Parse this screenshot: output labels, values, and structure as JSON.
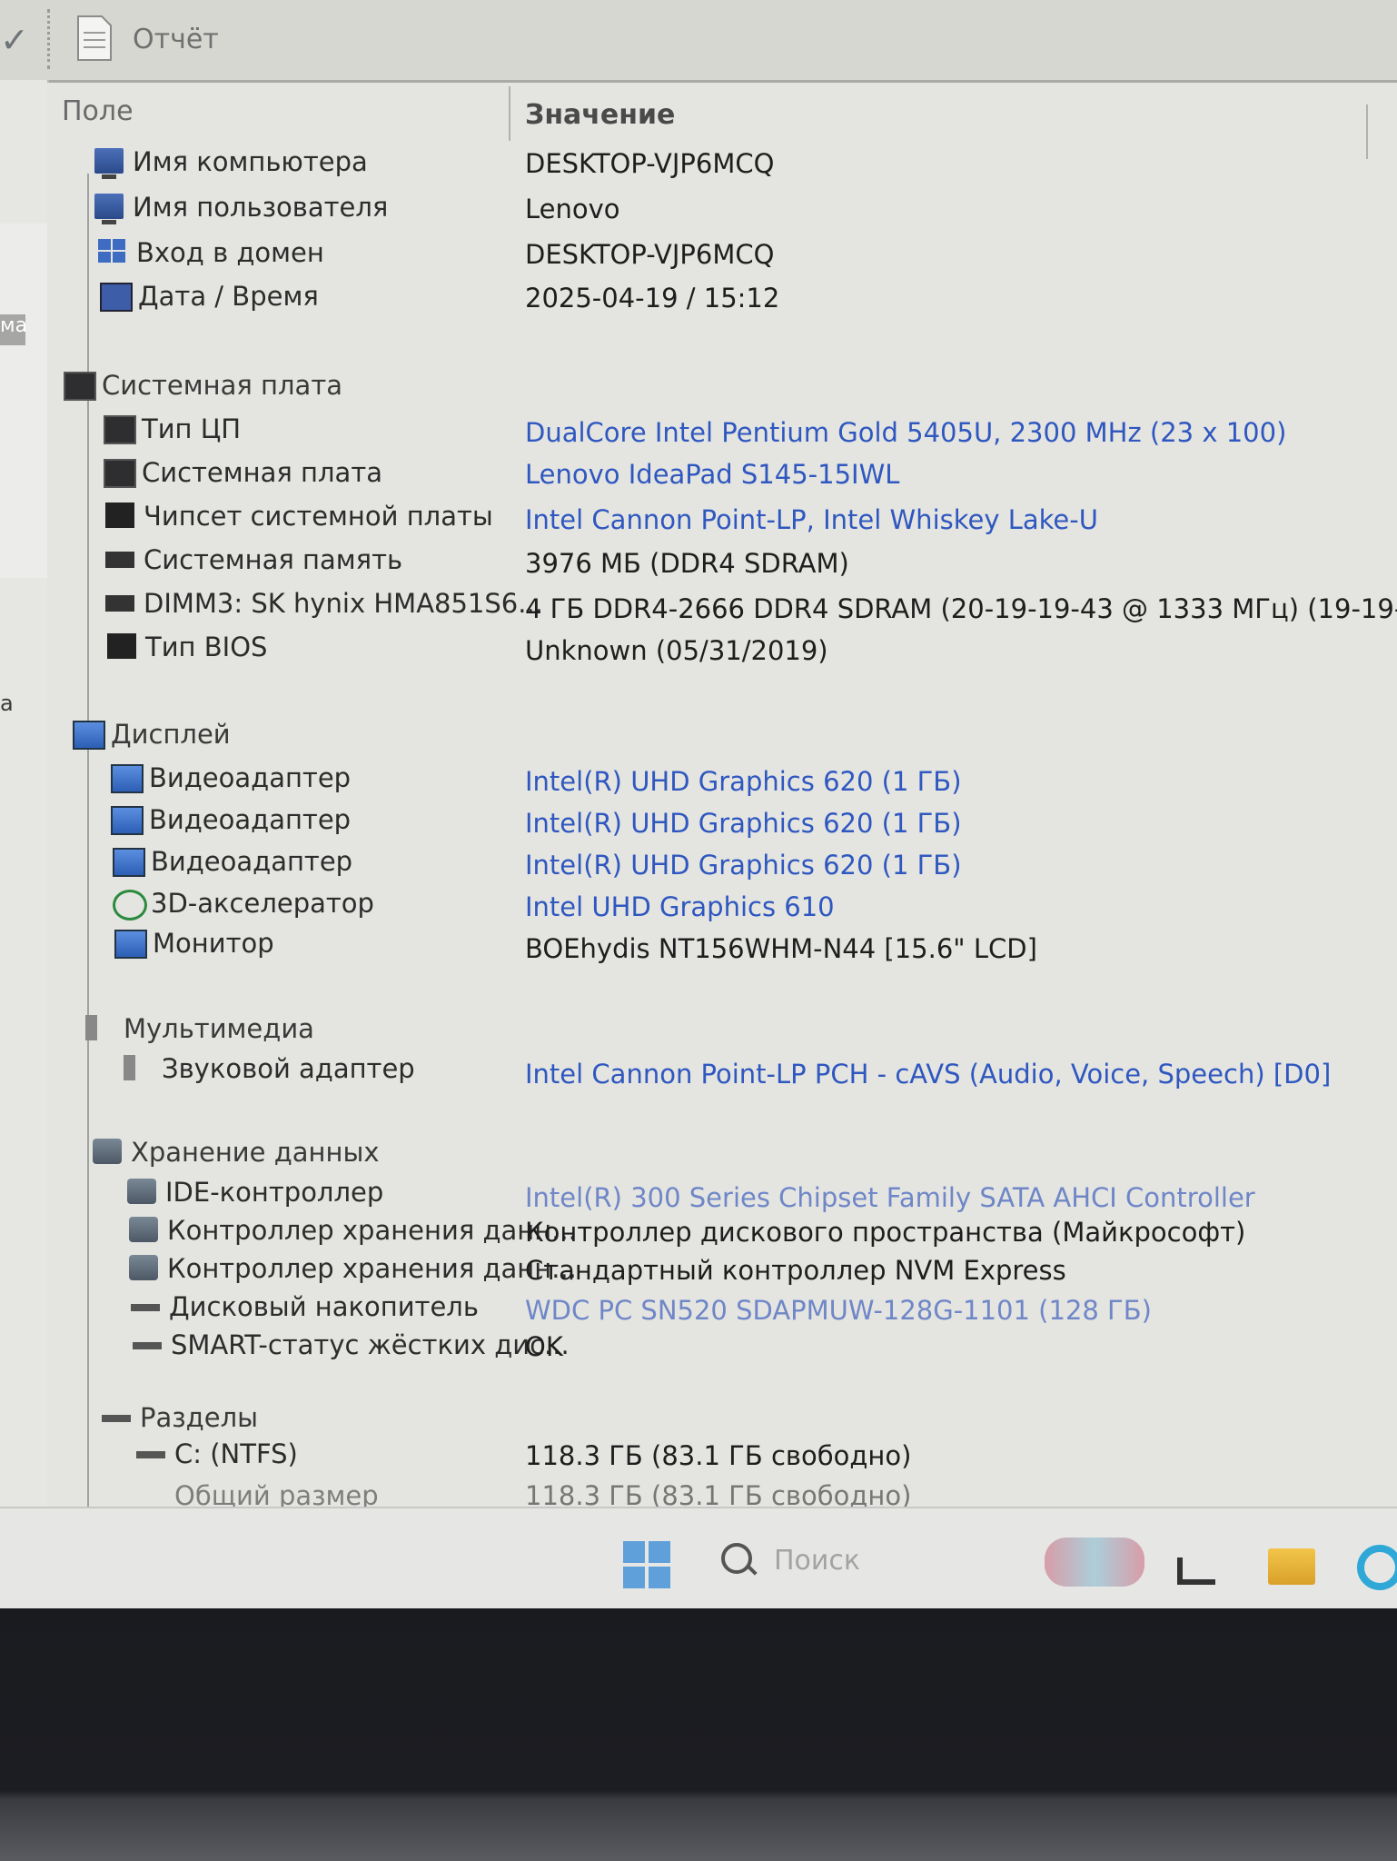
{
  "toolbar": {
    "report_label": "Отчёт",
    "left_tag_1": "ма",
    "left_tag_2": "а"
  },
  "columns": {
    "field": "Поле",
    "value": "Значение"
  },
  "rows": [
    {
      "label": "Имя компьютера",
      "value": "DESKTOP-VJP6MCQ",
      "icon": "computer-icon"
    },
    {
      "label": "Имя пользователя",
      "value": "Lenovo",
      "icon": "user-computer-icon"
    },
    {
      "label": "Вход в домен",
      "value": "DESKTOP-VJP6MCQ",
      "icon": "domain-icon"
    },
    {
      "label": "Дата / Время",
      "value": "2025-04-19 / 15:12",
      "icon": "calendar-icon"
    },
    {
      "label": "Системная плата",
      "value": "",
      "icon": "motherboard-icon",
      "group": true
    },
    {
      "label": "Тип ЦП",
      "value": "DualCore Intel Pentium Gold 5405U, 2300 MHz (23 x 100)",
      "icon": "cpu-icon"
    },
    {
      "label": "Системная плата",
      "value": "Lenovo IdeaPad S145-15IWL",
      "icon": "motherboard-icon"
    },
    {
      "label": "Чипсет системной платы",
      "value": "Intel Cannon Point-LP, Intel Whiskey Lake-U",
      "icon": "chipset-icon"
    },
    {
      "label": "Системная память",
      "value": "3976 МБ  (DDR4 SDRAM)",
      "icon": "memory-icon"
    },
    {
      "label": "DIMM3: SK hynix HMA851S6...",
      "value": "4 ГБ DDR4-2666 DDR4 SDRAM  (20-19-19-43 @ 1333 МГц)  (19-19-...",
      "icon": "memory-module-icon"
    },
    {
      "label": "Тип BIOS",
      "value": "Unknown (05/31/2019)",
      "icon": "bios-chip-icon"
    },
    {
      "label": "Дисплей",
      "value": "",
      "icon": "display-icon",
      "group": true
    },
    {
      "label": "Видеоадаптер",
      "value": "Intel(R) UHD Graphics 620  (1 ГБ)",
      "icon": "video-adapter-icon"
    },
    {
      "label": "Видеоадаптер",
      "value": "Intel(R) UHD Graphics 620  (1 ГБ)",
      "icon": "video-adapter-icon"
    },
    {
      "label": "Видеоадаптер",
      "value": "Intel(R) UHD Graphics 620  (1 ГБ)",
      "icon": "video-adapter-icon"
    },
    {
      "label": "3D-акселератор",
      "value": "Intel UHD Graphics 610",
      "icon": "xbox-icon"
    },
    {
      "label": "Монитор",
      "value": "BOEhydis NT156WHM-N44  [15.6\" LCD]",
      "icon": "monitor-icon"
    },
    {
      "label": "Мультимедиа",
      "value": "",
      "icon": "speaker-icon",
      "group": true
    },
    {
      "label": "Звуковой адаптер",
      "value": "Intel Cannon Point-LP PCH - cAVS (Audio, Voice, Speech) [D0]",
      "icon": "speaker-icon"
    },
    {
      "label": "Хранение данных",
      "value": "",
      "icon": "storage-icon",
      "group": true
    },
    {
      "label": "IDE-контроллер",
      "value": "Intel(R) 300 Series Chipset Family SATA AHCI Controller",
      "icon": "ide-controller-icon"
    },
    {
      "label": "Контроллер хранения данн...",
      "value": "Контроллер дискового пространства (Майкрософт)",
      "icon": "storage-controller-icon"
    },
    {
      "label": "Контроллер хранения данн...",
      "value": "Стандартный контроллер NVM Express",
      "icon": "storage-controller-icon"
    },
    {
      "label": "Дисковый накопитель",
      "value": "WDC PC SN520 SDAPMUW-128G-1101  (128 ГБ)",
      "icon": "disk-drive-icon"
    },
    {
      "label": "SMART-статус жёстких дис...",
      "value": "OK",
      "icon": "disk-drive-icon"
    },
    {
      "label": "Разделы",
      "value": "",
      "icon": "partition-icon",
      "group": true
    },
    {
      "label": "C: (NTFS)",
      "value": "118.3 ГБ (83.1 ГБ свободно)",
      "icon": "partition-icon"
    },
    {
      "label": "Общий размер",
      "value": "118.3 ГБ (83.1 ГБ свободно)",
      "icon": ""
    }
  ],
  "taskbar": {
    "search_label": "Поиск"
  },
  "colors": {
    "link": "#2f57c0",
    "text": "#1e1e1e",
    "background": "#e4e5e0"
  }
}
